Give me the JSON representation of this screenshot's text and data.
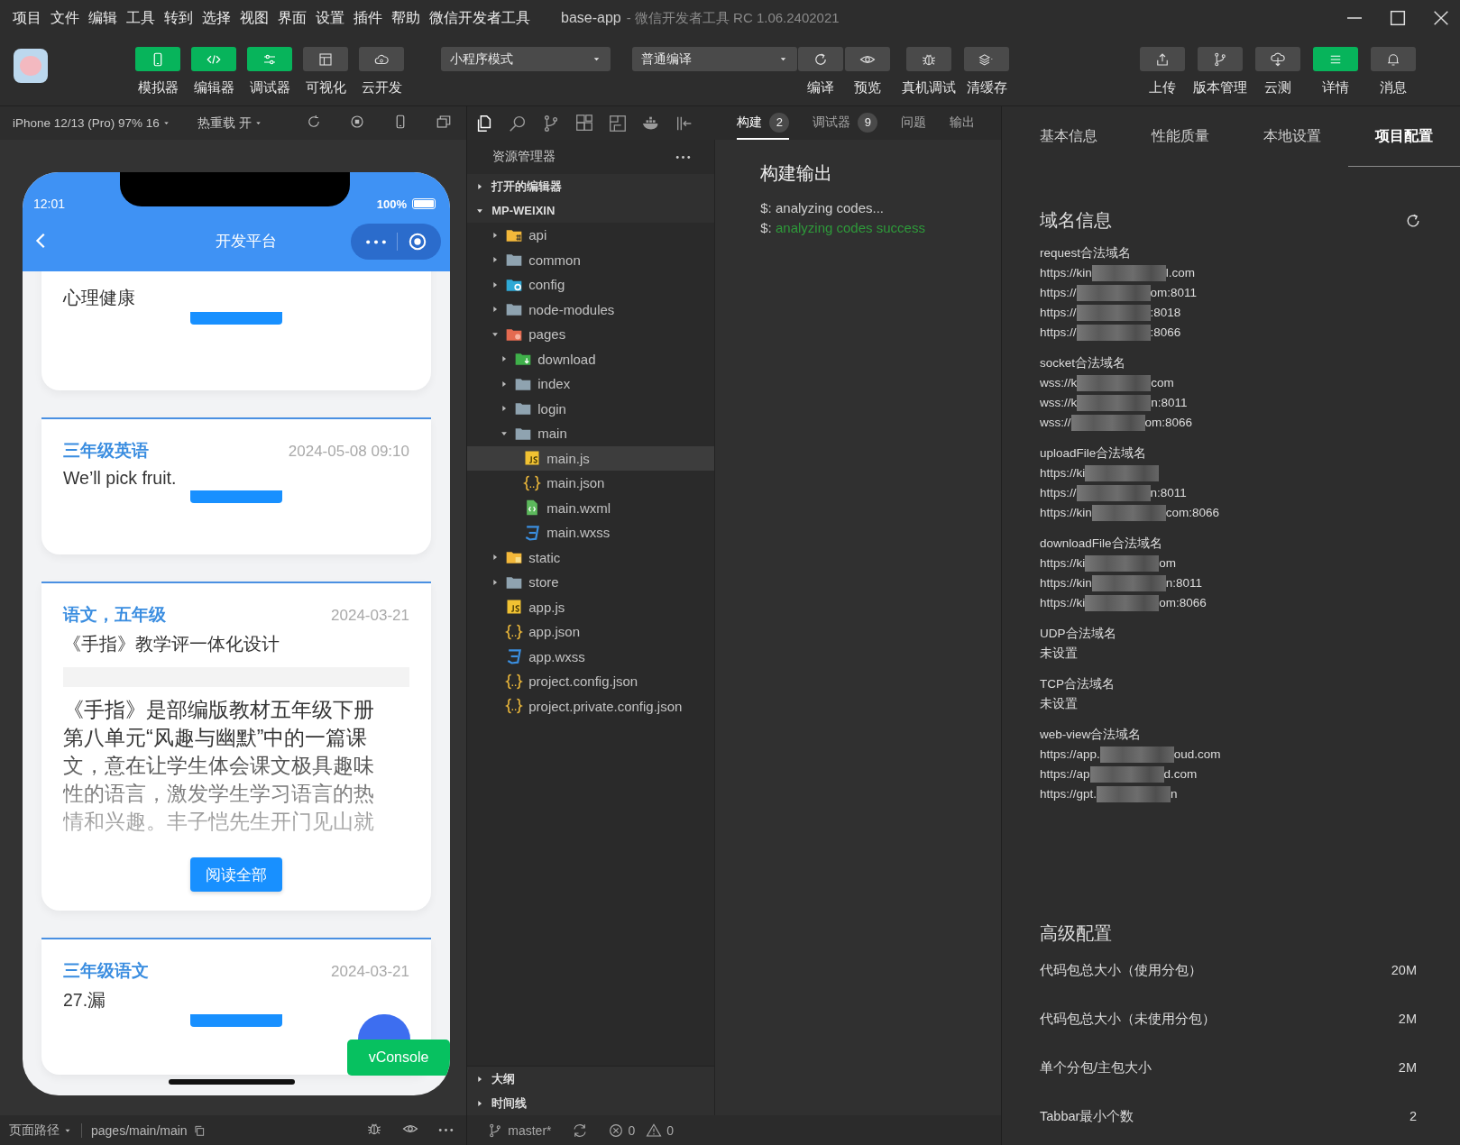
{
  "menu_bar": {
    "items": [
      "项目",
      "文件",
      "编辑",
      "工具",
      "转到",
      "选择",
      "视图",
      "界面",
      "设置",
      "插件",
      "帮助",
      "微信开发者工具"
    ],
    "app_name": "base-app",
    "app_title": "- 微信开发者工具 RC 1.06.2402021"
  },
  "toolbar": {
    "left_buttons": [
      {
        "label": "模拟器",
        "kind": "phone",
        "on": true
      },
      {
        "label": "编辑器",
        "kind": "code",
        "on": true
      },
      {
        "label": "调试器",
        "kind": "sliders",
        "on": true
      },
      {
        "label": "可视化",
        "kind": "layout",
        "on": false
      },
      {
        "label": "云开发",
        "kind": "cloud",
        "on": false
      }
    ],
    "mode_select": "小程序模式",
    "compile_select": "普通编译",
    "actions": [
      {
        "label": "编译",
        "kind": "refresh"
      },
      {
        "label": "预览",
        "kind": "eye"
      },
      {
        "label": "真机调试",
        "kind": "bug"
      },
      {
        "label": "清缓存",
        "kind": "layers"
      }
    ],
    "right_buttons": [
      {
        "label": "上传",
        "kind": "upload",
        "on": false
      },
      {
        "label": "版本管理",
        "kind": "branch",
        "on": false
      },
      {
        "label": "云测",
        "kind": "cloudtest",
        "on": false
      },
      {
        "label": "详情",
        "kind": "menu",
        "on": true
      },
      {
        "label": "消息",
        "kind": "bell",
        "on": false
      }
    ]
  },
  "simulator": {
    "device": "iPhone 12/13 (Pro) 97% 16",
    "hot_reload": "热重载 开",
    "phone": {
      "time": "12:01",
      "battery": "100%",
      "nav_title": "开发平台",
      "cards": [
        {
          "kind": "collapsed",
          "subtitle": "心理健康"
        },
        {
          "kind": "collapsed",
          "title": "三年级英语",
          "date": "2024-05-08 09:10",
          "subtitle": "We’ll pick fruit."
        },
        {
          "kind": "expanded",
          "title": "语文，五年级",
          "date": "2024-03-21",
          "subtitle": "《手指》教学评一体化设计",
          "body": "《手指》是部编版教材五年级下册第八单元“风趣与幽默”中的一篇课文，意在让学生体会课文极具趣味性的语言，激发学生学习语言的热情和兴趣。丰子恺先生开门见山就",
          "button": "阅读全部"
        },
        {
          "kind": "collapsed",
          "title": "三年级语文",
          "date": "2024-03-21",
          "subtitle": "27.漏"
        }
      ],
      "console_button": "vConsole"
    },
    "status": {
      "page_path_label": "页面路径",
      "path": "pages/main/main"
    }
  },
  "activity_bar": [
    {
      "kind": "files",
      "selected": true
    },
    {
      "kind": "search",
      "selected": false
    },
    {
      "kind": "branch",
      "selected": false
    },
    {
      "kind": "extensions",
      "selected": false
    },
    {
      "kind": "save",
      "selected": false
    },
    {
      "kind": "whale",
      "selected": false
    },
    {
      "kind": "collapse",
      "selected": false
    }
  ],
  "explorer": {
    "title": "资源管理器",
    "sections": [
      {
        "label": "打开的编辑器",
        "expanded": false
      },
      {
        "label": "MP-WEIXIN",
        "expanded": true,
        "children": [
          {
            "name": "api",
            "kind": "api-folder",
            "expanded": false,
            "selected": false
          },
          {
            "name": "common",
            "kind": "folder",
            "expanded": false,
            "selected": false
          },
          {
            "name": "config",
            "kind": "config-folder",
            "expanded": false,
            "selected": false
          },
          {
            "name": "node-modules",
            "kind": "folder",
            "expanded": false,
            "selected": false
          },
          {
            "name": "pages",
            "kind": "pages-folder",
            "expanded": true,
            "selected": false,
            "children": [
              {
                "name": "download",
                "kind": "download-folder",
                "expanded": false,
                "selected": false
              },
              {
                "name": "index",
                "kind": "folder",
                "expanded": false,
                "selected": false
              },
              {
                "name": "login",
                "kind": "folder",
                "expanded": false,
                "selected": false
              },
              {
                "name": "main",
                "kind": "folder",
                "expanded": true,
                "selected": false,
                "children": [
                  {
                    "name": "main.js",
                    "kind": "js",
                    "selected": true
                  },
                  {
                    "name": "main.json",
                    "kind": "json",
                    "selected": false
                  },
                  {
                    "name": "main.wxml",
                    "kind": "wxml",
                    "selected": false
                  },
                  {
                    "name": "main.wxss",
                    "kind": "wxss",
                    "selected": false
                  }
                ]
              }
            ]
          },
          {
            "name": "static",
            "kind": "static-folder",
            "expanded": false,
            "selected": false
          },
          {
            "name": "store",
            "kind": "folder",
            "expanded": false,
            "selected": false
          },
          {
            "name": "app.js",
            "kind": "js",
            "selected": false
          },
          {
            "name": "app.json",
            "kind": "json",
            "selected": false
          },
          {
            "name": "app.wxss",
            "kind": "wxss",
            "selected": false
          },
          {
            "name": "project.config.json",
            "kind": "json",
            "selected": false
          },
          {
            "name": "project.private.config.json",
            "kind": "json",
            "selected": false
          }
        ]
      }
    ],
    "bottom_sections": [
      {
        "label": "大纲",
        "expanded": false
      },
      {
        "label": "时间线",
        "expanded": false
      }
    ]
  },
  "build": {
    "tabs": [
      {
        "label": "构建",
        "count": "2",
        "selected": true
      },
      {
        "label": "调试器",
        "count": "9",
        "selected": false
      },
      {
        "label": "问题",
        "selected": false
      },
      {
        "label": "输出",
        "selected": false
      }
    ],
    "title": "构建输出",
    "lines": [
      {
        "prompt": "$:",
        "text": "analyzing codes...",
        "kind": "info"
      },
      {
        "prompt": "$:",
        "text": "analyzing codes success",
        "kind": "success"
      }
    ]
  },
  "status_bar": {
    "branch": "master*",
    "errors": "0",
    "warnings": "0"
  },
  "details": {
    "tabs": [
      {
        "label": "基本信息",
        "selected": false
      },
      {
        "label": "性能质量",
        "selected": false
      },
      {
        "label": "本地设置",
        "selected": false
      },
      {
        "label": "项目配置",
        "selected": true
      }
    ],
    "domain_title": "域名信息",
    "domain_groups": [
      {
        "label": "request合法域名",
        "entries": [
          {
            "prefix": "https://kin",
            "suffix": "l.com"
          },
          {
            "prefix": "https://",
            "suffix": "om:8011"
          },
          {
            "prefix": "https://",
            "suffix": ":8018"
          },
          {
            "prefix": "https://",
            "suffix": ":8066"
          }
        ]
      },
      {
        "label": "socket合法域名",
        "entries": [
          {
            "prefix": "wss://k",
            "suffix": "com"
          },
          {
            "prefix": "wss://k",
            "suffix": "n:8011"
          },
          {
            "prefix": "wss://",
            "suffix": "om:8066"
          }
        ]
      },
      {
        "label": "uploadFile合法域名",
        "entries": [
          {
            "prefix": "https://ki"
          },
          {
            "prefix": "https://",
            "suffix": "n:8011"
          },
          {
            "prefix": "https://kin",
            "suffix": "com:8066"
          }
        ]
      },
      {
        "label": "downloadFile合法域名",
        "entries": [
          {
            "prefix": "https://ki",
            "suffix": "om"
          },
          {
            "prefix": "https://kin",
            "suffix": "n:8011"
          },
          {
            "prefix": "https://ki",
            "suffix": "om:8066"
          }
        ]
      },
      {
        "label": "UDP合法域名",
        "value": "未设置"
      },
      {
        "label": "TCP合法域名",
        "value": "未设置"
      },
      {
        "label": "web-view合法域名",
        "entries": [
          {
            "prefix": "https://app.",
            "suffix": "oud.com"
          },
          {
            "prefix": "https://ap",
            "suffix": "d.com"
          },
          {
            "prefix": "https://gpt.",
            "suffix": "n"
          }
        ]
      }
    ],
    "advanced_title": "高级配置",
    "advanced_rows": [
      {
        "label": "代码包总大小（使用分包）",
        "value": "20M"
      },
      {
        "label": "代码包总大小（未使用分包）",
        "value": "2M"
      },
      {
        "label": "单个分包/主包大小",
        "value": "2M"
      },
      {
        "label": "Tabbar最小个数",
        "value": "2"
      }
    ]
  }
}
